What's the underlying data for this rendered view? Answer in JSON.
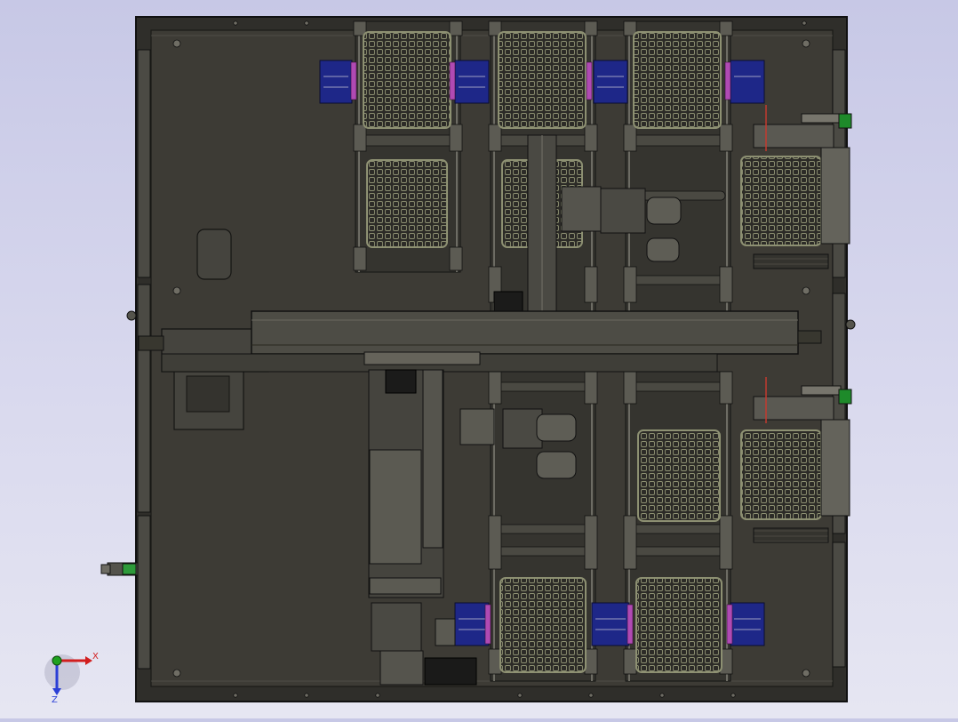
{
  "viewport": {
    "background_top": "#c7c8e6",
    "background_bottom": "#e6e6f2",
    "view": "top"
  },
  "model": {
    "plate_color": "#3d3b35",
    "frame_color": "#2f2e2a",
    "edge_color": "#121212",
    "tray_grid_color": "#8d9072",
    "blue_block_color": "#1e2788",
    "magenta_accent": "#b04ab3",
    "green_fitting": "#1e8a2a"
  },
  "triad": {
    "x_label": "X",
    "z_label": "Z",
    "x_color": "#d21e1e",
    "y_color": "#1fa11f",
    "z_color": "#2b3fd6"
  }
}
